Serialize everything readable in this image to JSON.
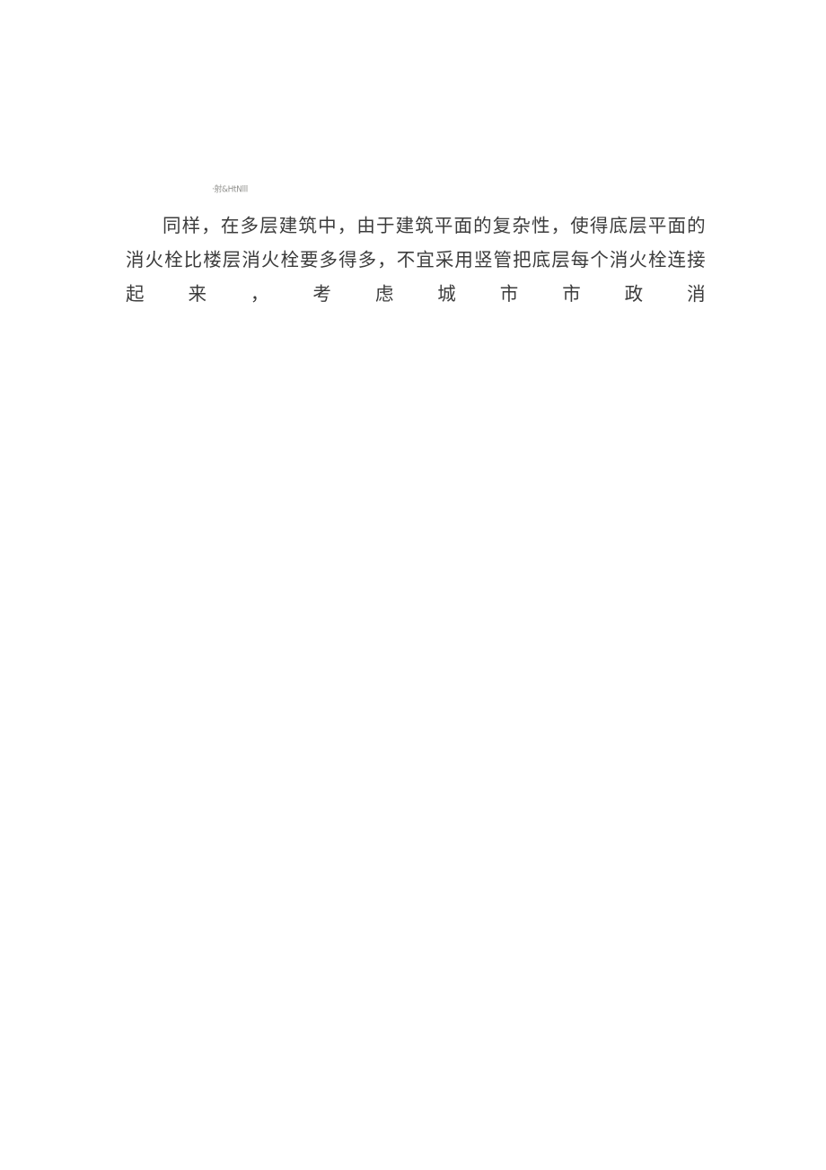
{
  "document": {
    "page_background": "#ffffff",
    "text_color": "#3c3c3c",
    "artifact_color": "#8a8a86",
    "scan_artifact": {
      "text": "·射&HtNlll"
    },
    "paragraph": {
      "text": "同样，在多层建筑中，由于建筑平面的复杂性，使得底层平面的消火栓比楼层消火栓要多得多，不宜采用竖管把底层每个消火栓连接起来，考虑城市市政消",
      "lines": [
        "同样，在多层建筑中，由于建筑平面的复杂性，使得底层平面的消火栓比",
        "楼层消火栓要多得多，不宜采用竖管把底层每个消火栓连接起来，考虑城市市",
        "政消"
      ]
    }
  }
}
